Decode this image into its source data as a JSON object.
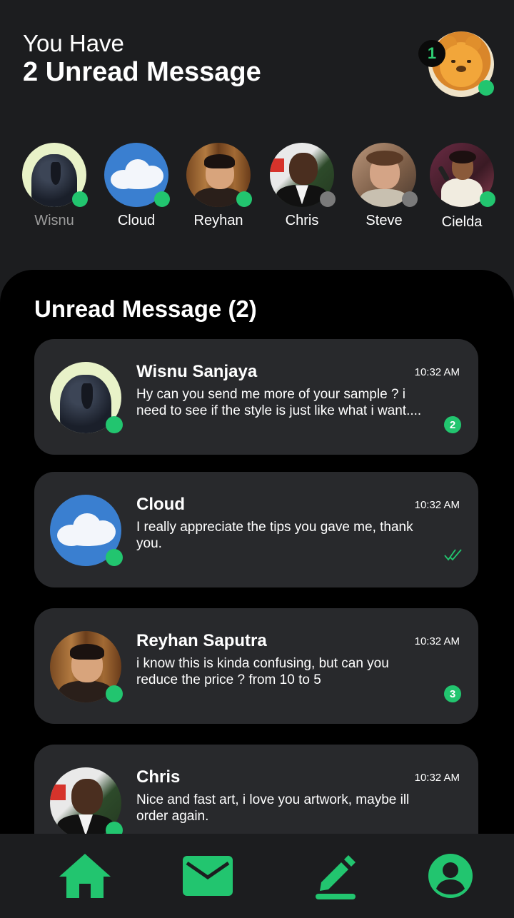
{
  "header": {
    "line1": "You Have",
    "line2": "2 Unread Message",
    "notification_count": "1"
  },
  "stories": [
    {
      "name": "Wisnu",
      "status": "online",
      "avatar": "crow"
    },
    {
      "name": "Cloud",
      "status": "online",
      "avatar": "cloud"
    },
    {
      "name": "Reyhan",
      "status": "online",
      "avatar": "reyhan"
    },
    {
      "name": "Chris",
      "status": "offline",
      "avatar": "chris"
    },
    {
      "name": "Steve",
      "status": "offline",
      "avatar": "steve"
    },
    {
      "name": "Cielda",
      "status": "online",
      "avatar": "cielda"
    }
  ],
  "unread": {
    "title": "Unread Message (2)",
    "messages": [
      {
        "sender": "Wisnu Sanjaya",
        "time": "10:32 AM",
        "preview": "Hy can you send me more of your sample ? i need to see if the style is just like what i want....",
        "badge": "2",
        "avatar": "crow"
      },
      {
        "sender": "Cloud",
        "time": "10:32 AM",
        "preview": "I really appreciate the tips you gave me, thank you.",
        "badge": "",
        "status_icon": "double-check-icon",
        "avatar": "cloud"
      },
      {
        "sender": "Reyhan Saputra",
        "time": "10:32 AM",
        "preview": "i know this is kinda confusing, but can you reduce the price ? from 10 to 5",
        "badge": "3",
        "avatar": "reyhan"
      },
      {
        "sender": "Chris",
        "time": "10:32 AM",
        "preview": "Nice and fast art, i love you artwork, maybe ill order again.",
        "badge": "",
        "avatar": "chris"
      }
    ]
  },
  "nav": {
    "items": [
      "home-icon",
      "mail-icon",
      "edit-icon",
      "profile-icon"
    ]
  },
  "colors": {
    "accent": "#22c56f",
    "offline": "#7a7a7a",
    "background": "#1c1d1f",
    "panel": "#000000",
    "card": "#28292c"
  }
}
